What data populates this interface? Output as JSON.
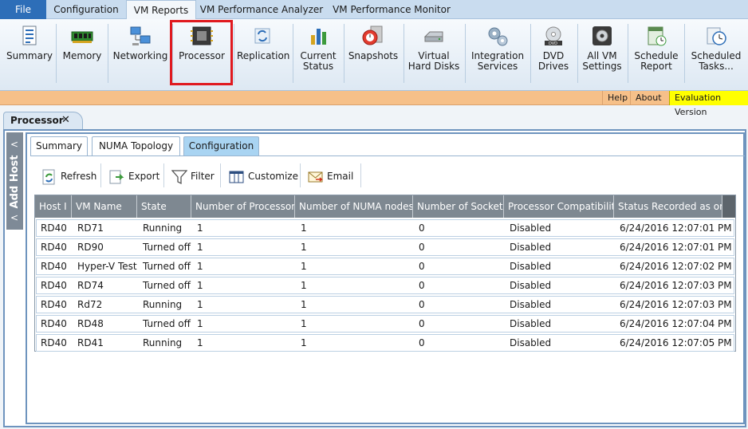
{
  "menu": {
    "tabs": [
      "File",
      "Configuration",
      "VM Reports",
      "VM Performance Analyzer",
      "VM Performance Monitor"
    ],
    "active": "VM Reports"
  },
  "ribbon": {
    "buttons": [
      {
        "line1": "Summary",
        "line2": ""
      },
      {
        "line1": "Memory",
        "line2": ""
      },
      {
        "line1": "Networking",
        "line2": ""
      },
      {
        "line1": "Processor",
        "line2": ""
      },
      {
        "line1": "Replication",
        "line2": ""
      },
      {
        "line1": "Current",
        "line2": "Status"
      },
      {
        "line1": "Snapshots",
        "line2": ""
      },
      {
        "line1": "Virtual",
        "line2": "Hard Disks"
      },
      {
        "line1": "Integration",
        "line2": "Services"
      },
      {
        "line1": "DVD",
        "line2": "Drives"
      },
      {
        "line1": "All VM",
        "line2": "Settings"
      },
      {
        "line1": "Schedule",
        "line2": "Report"
      },
      {
        "line1": "Scheduled",
        "line2": "Tasks..."
      }
    ],
    "dvd_icon_text": "DVD"
  },
  "infobar": {
    "help": "Help",
    "about": "About",
    "evaluation": "Evaluation Version"
  },
  "doc_tab": {
    "label": "Processor",
    "close": "✕"
  },
  "side_panel": {
    "label": "Add Host",
    "chevron": "<"
  },
  "sub_tabs": [
    "Summary",
    "NUMA Topology",
    "Configuration"
  ],
  "active_sub_tab": "Configuration",
  "toolbar": {
    "refresh": "Refresh",
    "export": "Export",
    "filter": "Filter",
    "customize": "Customize",
    "email": "Email"
  },
  "table": {
    "columns": [
      "Host I",
      "VM Name",
      "State",
      "Number of Processors",
      "Number of NUMA nodes",
      "Number of Sockets",
      "Processor Compatibility",
      "Status Recorded as on"
    ],
    "rows": [
      [
        "RD40",
        "RD71",
        "Running",
        "1",
        "1",
        "0",
        "Disabled",
        "6/24/2016 12:07:01 PM"
      ],
      [
        "RD40",
        "RD90",
        "Turned off",
        "1",
        "1",
        "0",
        "Disabled",
        "6/24/2016 12:07:01 PM"
      ],
      [
        "RD40",
        "Hyper-V Test",
        "Turned off",
        "1",
        "1",
        "0",
        "Disabled",
        "6/24/2016 12:07:02 PM"
      ],
      [
        "RD40",
        "RD74",
        "Turned off",
        "1",
        "1",
        "0",
        "Disabled",
        "6/24/2016 12:07:03 PM"
      ],
      [
        "RD40",
        "Rd72",
        "Running",
        "1",
        "1",
        "0",
        "Disabled",
        "6/24/2016 12:07:03 PM"
      ],
      [
        "RD40",
        "RD48",
        "Turned off",
        "1",
        "1",
        "0",
        "Disabled",
        "6/24/2016 12:07:04 PM"
      ],
      [
        "RD40",
        "RD41",
        "Running",
        "1",
        "1",
        "0",
        "Disabled",
        "6/24/2016 12:07:05 PM"
      ]
    ]
  },
  "colors": {
    "accent": "#2d6eb8",
    "highlight": "#e0191f",
    "infobar": "#f6c089",
    "evaluation": "#ffff00",
    "header": "#7e8891"
  }
}
